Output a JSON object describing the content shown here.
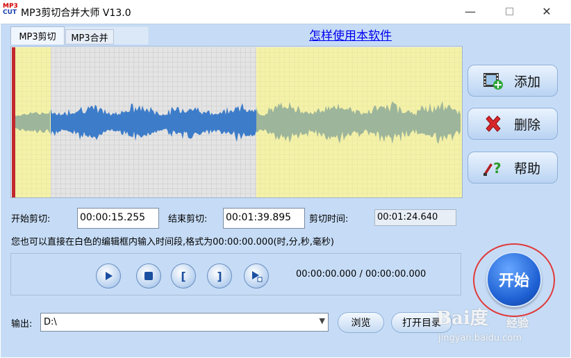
{
  "window": {
    "title": "MP3剪切合并大师 V13.0",
    "logo_top": "MP3",
    "logo_bottom": "CUT",
    "minimize_glyph": "—",
    "close_glyph": "✕"
  },
  "tabs": [
    {
      "label": "MP3剪切",
      "active": true
    },
    {
      "label": "MP3合并",
      "active": false
    }
  ],
  "help_link": "怎样使用本软件",
  "side_buttons": [
    {
      "label": "添加",
      "icon": "film-add-icon"
    },
    {
      "label": "删除",
      "icon": "red-x-icon"
    },
    {
      "label": "帮助",
      "icon": "help-question-icon"
    }
  ],
  "cut": {
    "start_label": "开始剪切:",
    "start_value": "00:00:15.255",
    "end_label": "结束剪切:",
    "end_value": "00:01:39.895",
    "duration_label": "剪切时间:",
    "duration_value": "00:01:24.640"
  },
  "hint": "您也可以直接在白色的编辑框内输入时间段,格式为00:00:00.000(时,分,秒,毫秒)",
  "player": {
    "position_readout": "00:00:00.000 / 00:00:00.000",
    "set_start_glyph": "[",
    "set_end_glyph": "]"
  },
  "start_button": "开始",
  "output": {
    "label": "输出:",
    "value": "D:\\",
    "browse": "浏览",
    "open_dir": "打开目录"
  },
  "watermark": {
    "brand": "Bai度",
    "brand2": "经验",
    "url": "jingyan.baidu.com"
  },
  "colors": {
    "background": "#c6dcf6",
    "selection": "#e4e4e4",
    "unselected": "#f4f2a8",
    "wave_selected": "#3d7cc9",
    "wave_unselected": "#9db59a",
    "playhead": "#c0282e"
  }
}
